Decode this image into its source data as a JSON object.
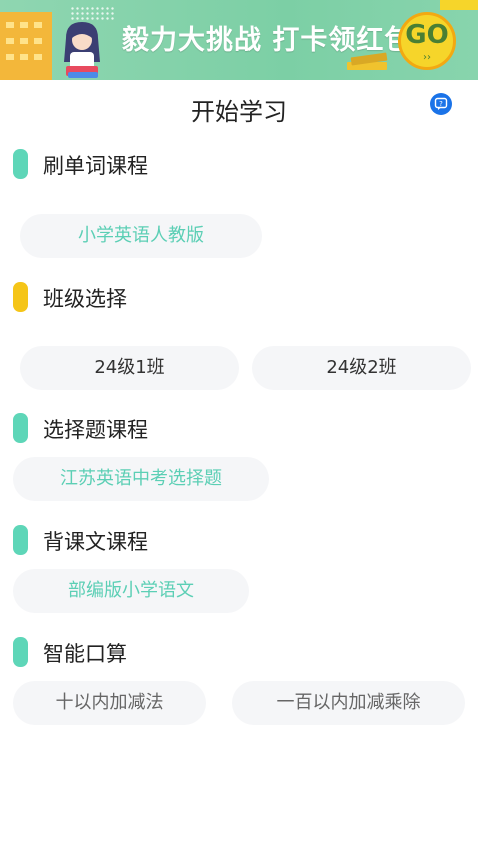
{
  "banner": {
    "headline": "毅力大挑战 打卡领红包",
    "go_label": "GO",
    "go_arrow": "››"
  },
  "header": {
    "title": "开始学习"
  },
  "sections": {
    "vocab": {
      "title": "刷单词课程",
      "bar_color": "#5ed6b8",
      "chips": [
        "小学英语人教版"
      ]
    },
    "class": {
      "title": "班级选择",
      "bar_color": "#f5c518",
      "chips": [
        "24级1班",
        "24级2班"
      ]
    },
    "choice": {
      "title": "选择题课程",
      "bar_color": "#5ed6b8",
      "chips": [
        "江苏英语中考选择题"
      ]
    },
    "recite": {
      "title": "背课文课程",
      "bar_color": "#5ed6b8",
      "chips": [
        "部编版小学语文"
      ]
    },
    "math": {
      "title": "智能口算",
      "bar_color": "#5ed6b8",
      "chips": [
        "十以内加减法",
        "一百以内加减乘除"
      ]
    }
  },
  "icons": {
    "help": "chat-help-icon"
  }
}
